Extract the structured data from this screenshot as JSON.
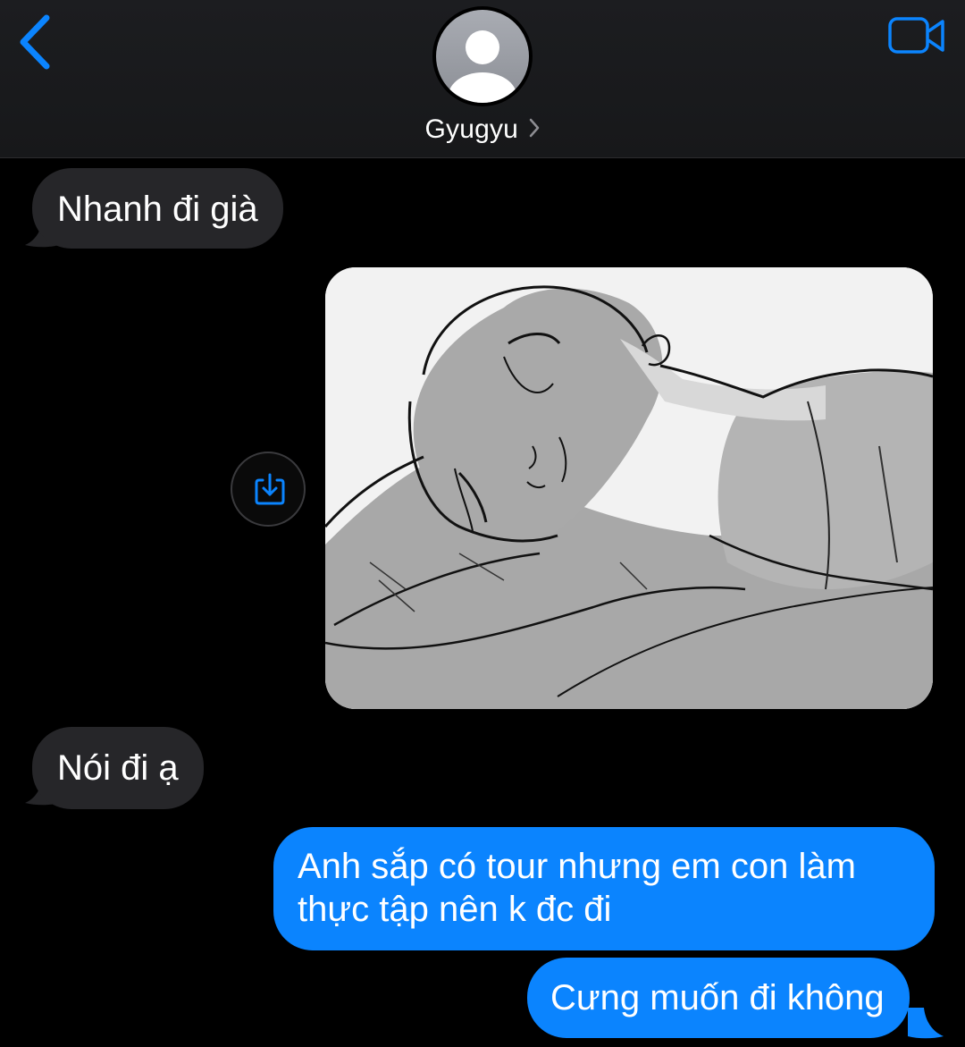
{
  "header": {
    "contact_name": "Gyugyu",
    "back_icon": "chevron-left-icon",
    "video_icon": "video-camera-icon",
    "avatar_icon": "person-silhouette-icon",
    "accent_color": "#0b84fe"
  },
  "messages": [
    {
      "direction": "incoming",
      "text": "Nhanh đi già"
    },
    {
      "direction": "outgoing",
      "type": "image",
      "save_icon": "save-to-photos-icon"
    },
    {
      "direction": "incoming",
      "text": "Nói đi ạ"
    },
    {
      "direction": "outgoing",
      "text_line1": "Anh sắp có tour nhưng em con làm",
      "text_line2": "thực tập nên k đc đi"
    },
    {
      "direction": "outgoing",
      "text": "Cưng muốn đi không"
    }
  ],
  "colors": {
    "background": "#000000",
    "incoming_bubble": "#262629",
    "outgoing_bubble": "#0b84fe",
    "text": "#ffffff"
  }
}
